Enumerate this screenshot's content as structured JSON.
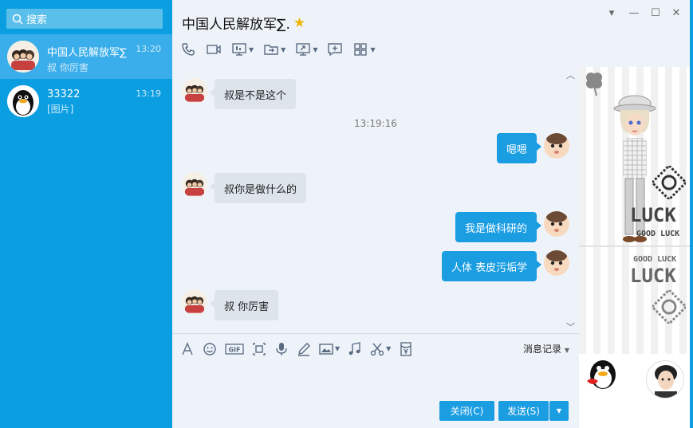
{
  "search": {
    "placeholder": "搜索"
  },
  "contacts": [
    {
      "name": "中国人民解放军∑",
      "preview": "叔 你厉害",
      "time": "13:20",
      "active": true
    },
    {
      "name": "33322",
      "preview": "[图片]",
      "time": "13:19",
      "active": false
    }
  ],
  "chat": {
    "title": "中国人民解放军∑.",
    "title_star_icon": "star-icon",
    "messages": [
      {
        "from": "them",
        "text": "叔是不是这个"
      },
      {
        "from": "me",
        "text": "嗯嗯"
      },
      {
        "from": "them",
        "text": "叔你是做什么的"
      },
      {
        "from": "me",
        "text": "我是做科研的"
      },
      {
        "from": "me",
        "text": "人体 表皮污垢学"
      },
      {
        "from": "them",
        "text": "叔 你厉害"
      }
    ],
    "timestamp": "13:19:16",
    "history_label": "消息记录",
    "close_label": "关闭(C)",
    "send_label": "发送(S)"
  },
  "toolbar_icons": [
    "phone-icon",
    "video-icon",
    "screen-share-icon",
    "file-transfer-icon",
    "remote-desktop-icon",
    "message-icon",
    "apps-icon"
  ],
  "input_toolbar_icons": [
    "font-icon",
    "emoji-icon",
    "gif-icon",
    "screenshot-icon",
    "voice-icon",
    "pen-icon",
    "image-icon",
    "music-icon",
    "scissors-icon",
    "red-packet-icon"
  ],
  "decor": {
    "luck_text": "LUCK",
    "good_luck_text": "GOOD LUCK"
  },
  "colors": {
    "sidebar": "#0b9ee0",
    "bubble_out": "#1b9de2",
    "bubble_in": "#dde4ec",
    "background": "#eef3fa"
  }
}
